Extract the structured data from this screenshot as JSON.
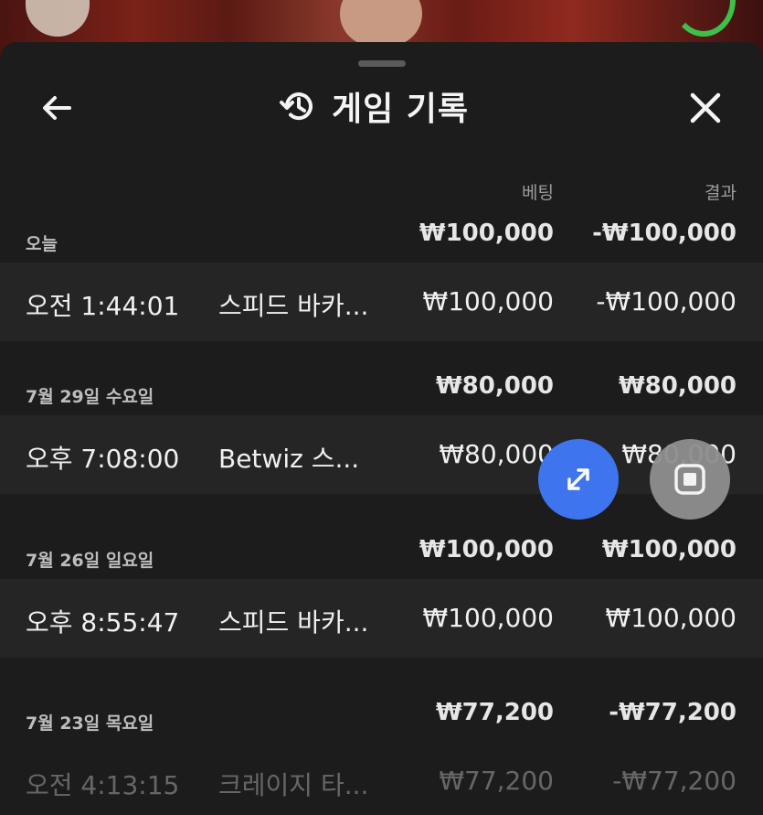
{
  "header": {
    "title": "게임 기록"
  },
  "columns": {
    "bet": "베팅",
    "result": "결과"
  },
  "groups": [
    {
      "date": "오늘",
      "sum_bet": "₩100,000",
      "sum_result": "-₩100,000",
      "rows": [
        {
          "time": "오전 1:44:01",
          "game": "스피드 바카...",
          "bet": "₩100,000",
          "result": "-₩100,000"
        }
      ]
    },
    {
      "date": "7월 29일 수요일",
      "sum_bet": "₩80,000",
      "sum_result": "₩80,000",
      "rows": [
        {
          "time": "오후 7:08:00",
          "game": "Betwiz 스...",
          "bet": "₩80,000",
          "result": "₩80,000"
        }
      ]
    },
    {
      "date": "7월 26일 일요일",
      "sum_bet": "₩100,000",
      "sum_result": "₩100,000",
      "rows": [
        {
          "time": "오후 8:55:47",
          "game": "스피드 바카...",
          "bet": "₩100,000",
          "result": "₩100,000"
        }
      ]
    },
    {
      "date": "7월 23일 목요일",
      "sum_bet": "₩77,200",
      "sum_result": "-₩77,200",
      "rows": [
        {
          "time": "오전 4:13:15",
          "game": "크레이지 타...",
          "bet": "₩77,200",
          "result": "-₩77,200"
        }
      ]
    }
  ],
  "colors": {
    "sheet": "#1c1c1c",
    "row": "#252525",
    "accent": "#3f74ef",
    "stop_button": "#8f8f8f"
  },
  "icons": {
    "back": "arrow-left-icon",
    "history": "history-icon",
    "close": "close-icon",
    "expand": "expand-icon",
    "stop": "stop-icon"
  }
}
